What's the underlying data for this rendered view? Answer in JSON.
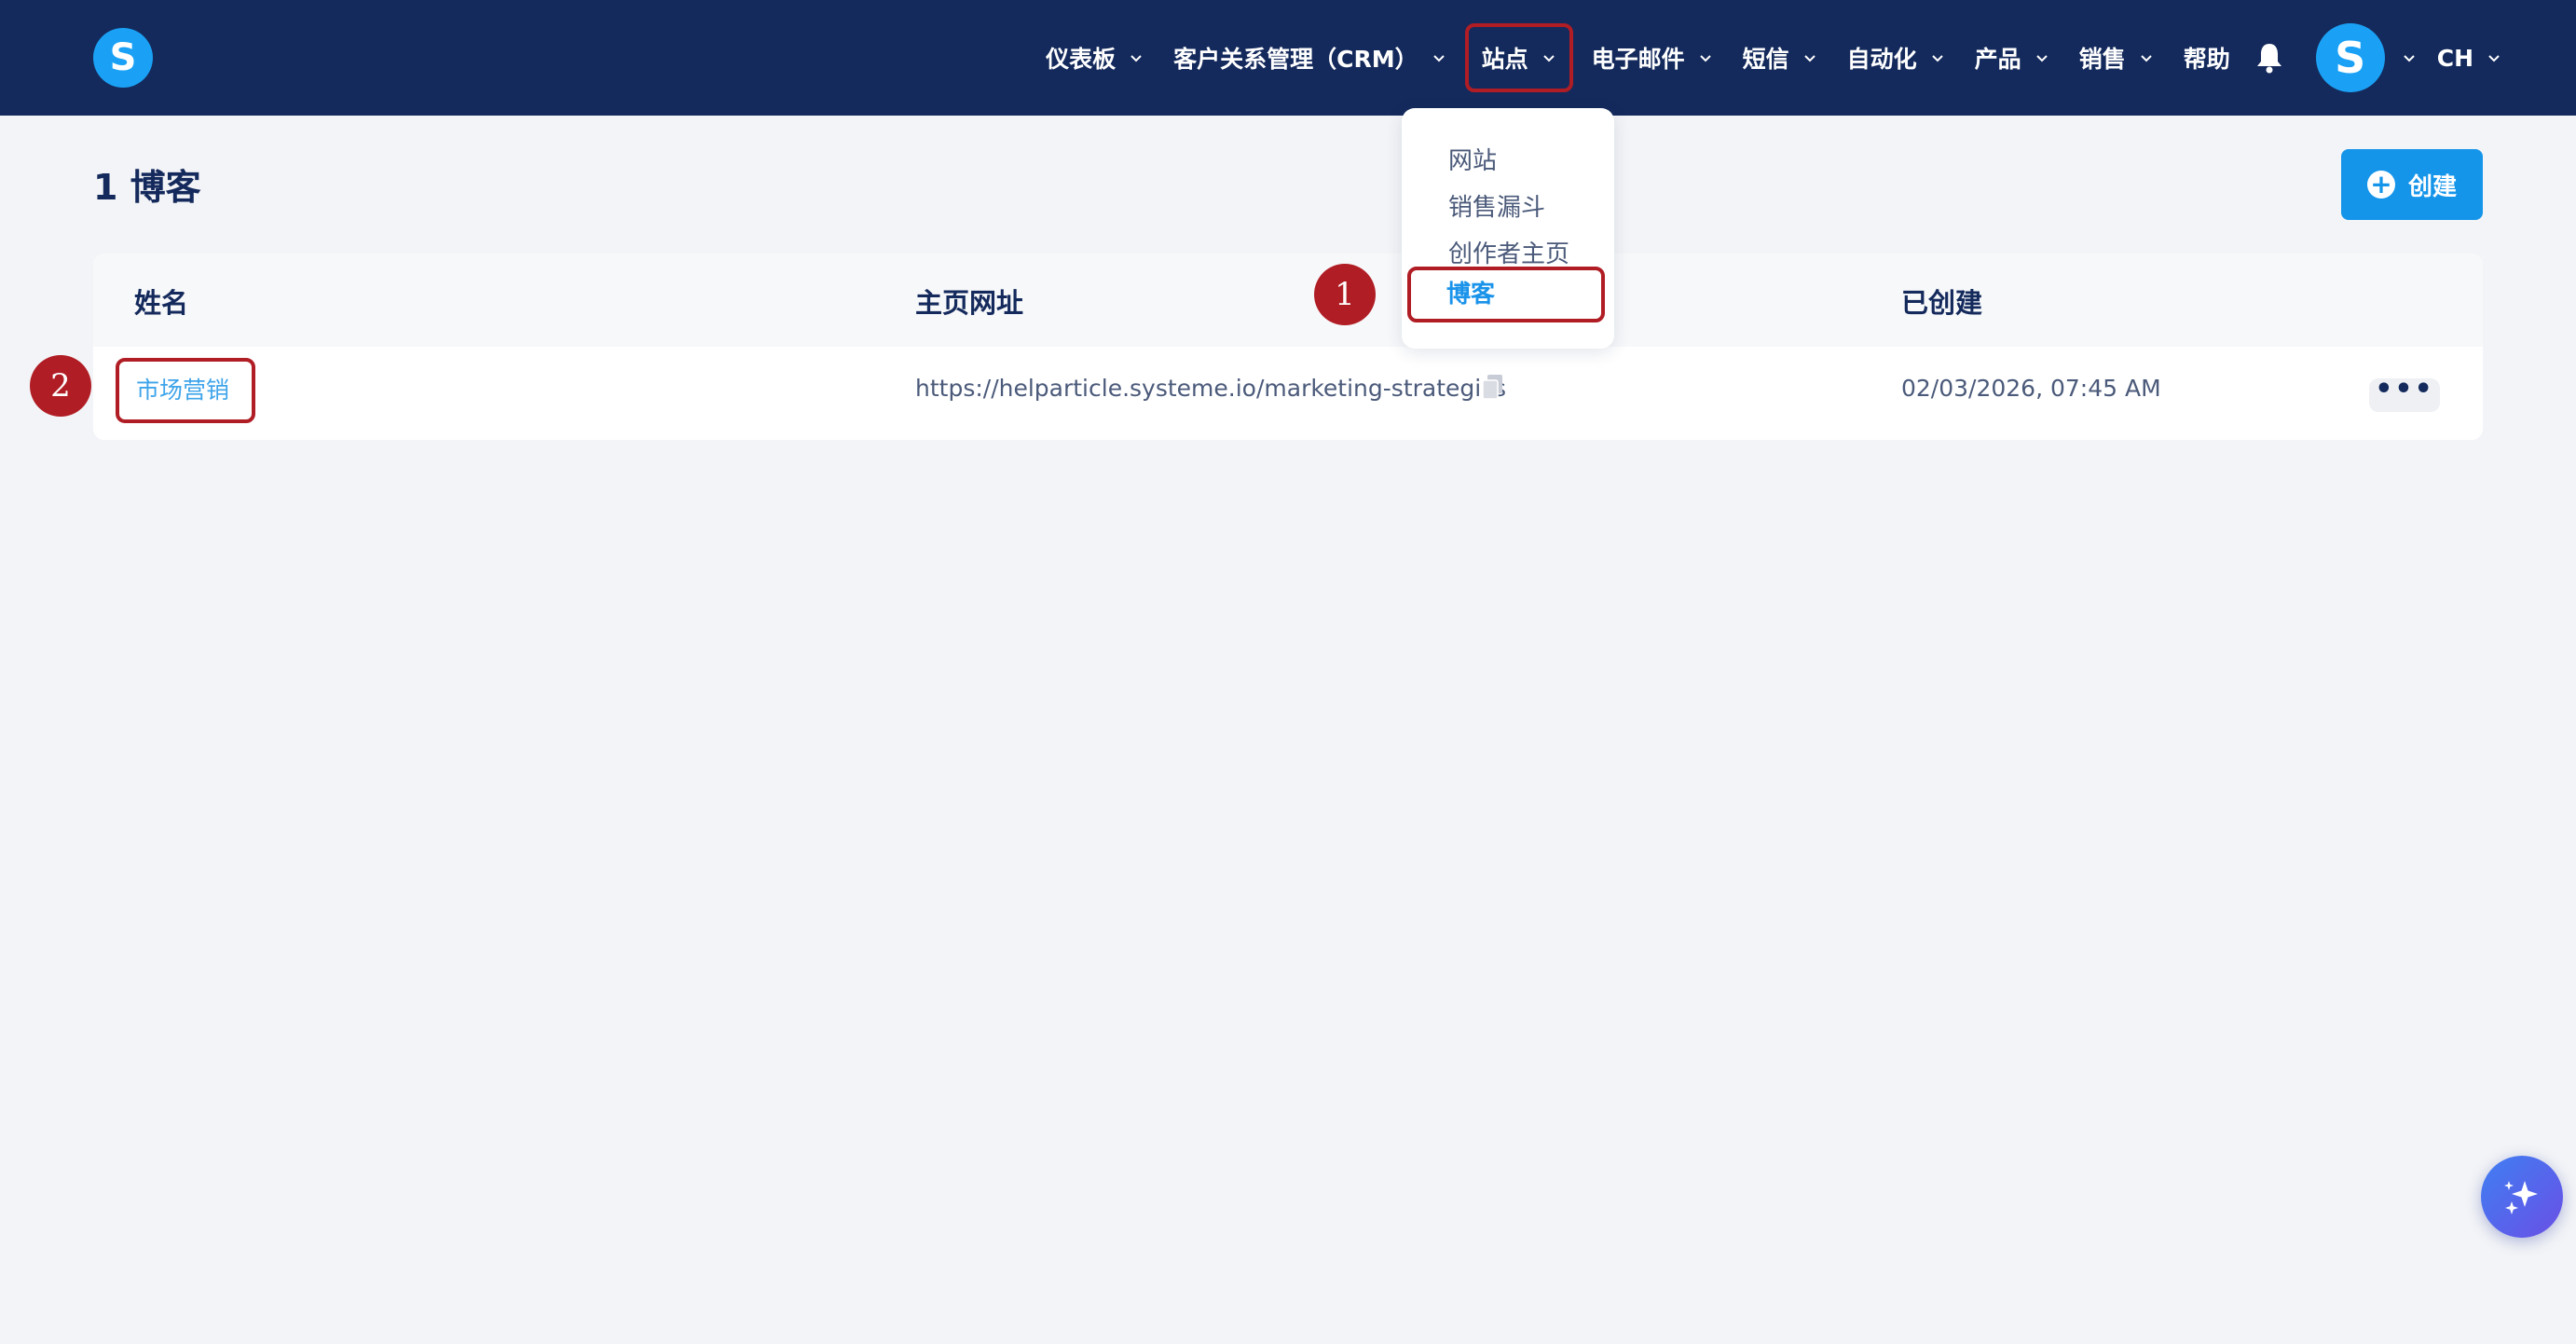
{
  "brand": {
    "logo_letter": "S"
  },
  "nav": {
    "items": [
      {
        "label": "仪表板",
        "has_dropdown": true
      },
      {
        "label": "客户关系管理（CRM）",
        "has_dropdown": true
      },
      {
        "label": "站点",
        "has_dropdown": true,
        "active": true
      },
      {
        "label": "电子邮件",
        "has_dropdown": true
      },
      {
        "label": "短信",
        "has_dropdown": true
      },
      {
        "label": "自动化",
        "has_dropdown": true
      },
      {
        "label": "产品",
        "has_dropdown": true
      },
      {
        "label": "销售",
        "has_dropdown": true
      },
      {
        "label": "帮助",
        "has_dropdown": false
      }
    ],
    "avatar_letter": "S",
    "language": "CH"
  },
  "sites_dropdown": {
    "items": [
      "网站",
      "销售漏斗",
      "创作者主页",
      "博客"
    ],
    "selected": "博客"
  },
  "page": {
    "title": "1 博客",
    "create_label": "创建"
  },
  "table": {
    "headers": [
      "姓名",
      "主页网址",
      "已创建"
    ],
    "rows": [
      {
        "name": "市场营销",
        "url": "https://helparticle.systeme.io/marketing-strategics",
        "created": "02/03/2026, 07:45 AM",
        "more": "•••"
      }
    ]
  },
  "annotations": [
    "1",
    "2"
  ],
  "colors": {
    "topbar": "#142a5c",
    "accent": "#1595ea",
    "highlight": "#b01d24",
    "link": "#3ea4ea",
    "background": "#f3f4f7"
  },
  "icons": [
    "chevron-down-icon",
    "bell-icon",
    "copy-icon",
    "plus-circle-icon",
    "sparkle-icon"
  ]
}
